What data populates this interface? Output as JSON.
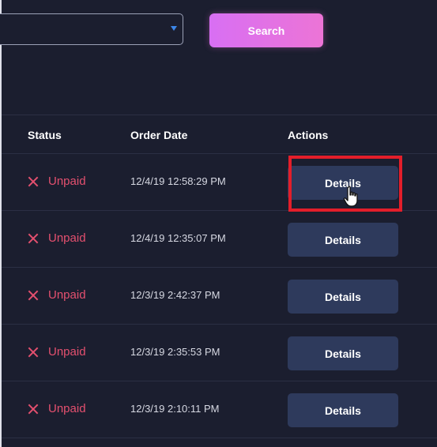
{
  "toolbar": {
    "search_label": "Search"
  },
  "table": {
    "headers": {
      "status": "Status",
      "order_date": "Order Date",
      "actions": "Actions"
    },
    "rows": [
      {
        "status": "Unpaid",
        "date": "12/4/19 12:58:29 PM",
        "action": "Details"
      },
      {
        "status": "Unpaid",
        "date": "12/4/19 12:35:07 PM",
        "action": "Details"
      },
      {
        "status": "Unpaid",
        "date": "12/3/19 2:42:37 PM",
        "action": "Details"
      },
      {
        "status": "Unpaid",
        "date": "12/3/19 2:35:53 PM",
        "action": "Details"
      },
      {
        "status": "Unpaid",
        "date": "12/3/19 2:10:11 PM",
        "action": "Details"
      }
    ]
  },
  "colors": {
    "background": "#1b1e2f",
    "accent": "#ec74d6",
    "unpaid": "#e4506f",
    "button": "#2e3a5c",
    "highlight": "#e31e2a"
  }
}
